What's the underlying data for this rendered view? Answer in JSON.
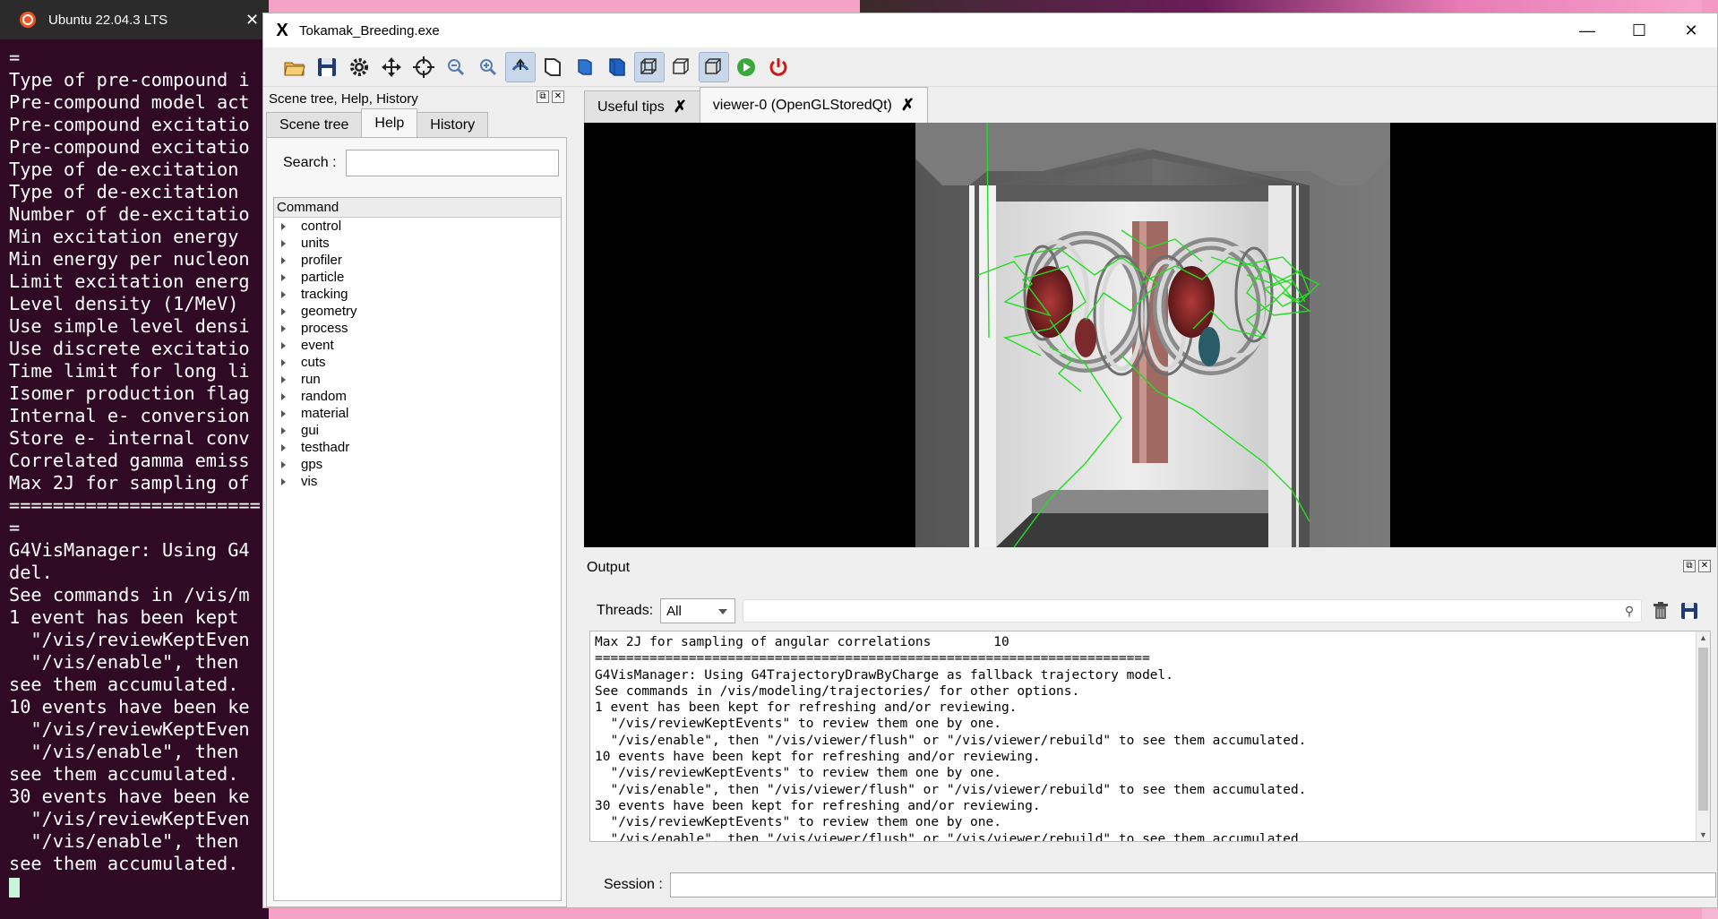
{
  "terminal": {
    "title": "Ubuntu 22.04.3 LTS",
    "close": "✕",
    "lines": [
      "=",
      "Type of pre-compound i",
      "Pre-compound model act",
      "Pre-compound excitatio",
      "Pre-compound excitatio",
      "Type of de-excitation",
      "Type of de-excitation",
      "Number of de-excitatio",
      "Min excitation energy",
      "Min energy per nucleon",
      "Limit excitation energ",
      "Level density (1/MeV)",
      "Use simple level densi",
      "Use discrete excitatio",
      "Time limit for long li",
      "Isomer production flag",
      "Internal e- conversion",
      "Store e- internal conv",
      "Correlated gamma emiss",
      "Max 2J for sampling of",
      "=======================",
      "=",
      "G4VisManager: Using G4",
      "del.",
      "See commands in /vis/m",
      "1 event has been kept",
      "  \"/vis/reviewKeptEven",
      "  \"/vis/enable\", then",
      "see them accumulated.",
      "10 events have been ke",
      "  \"/vis/reviewKeptEven",
      "  \"/vis/enable\", then",
      "see them accumulated.",
      "30 events have been ke",
      "  \"/vis/reviewKeptEven",
      "  \"/vis/enable\", then",
      "see them accumulated."
    ]
  },
  "window": {
    "title": "Tokamak_Breeding.exe",
    "icon": "X",
    "minimize": "—",
    "maximize": "☐",
    "close": "✕"
  },
  "toolbar": {
    "buttons": [
      "open-icon",
      "save-icon",
      "settings-icon",
      "move-icon",
      "pick-icon",
      "zoom-out-icon",
      "zoom-in-icon",
      "rotate-icon",
      "perspective-icon",
      "surface-icon",
      "solid-icon",
      "wireframe-icon",
      "hidden-line-icon",
      "hidden-surface-icon",
      "run-icon",
      "exit-icon"
    ],
    "active": [
      "rotate-icon",
      "wireframe-icon",
      "hidden-surface-icon"
    ]
  },
  "left_dock": {
    "title": "Scene tree, Help, History",
    "tabs": [
      "Scene tree",
      "Help",
      "History"
    ],
    "active_tab": "Help",
    "search_label": "Search :",
    "search_value": "",
    "tree_header": "Command",
    "commands": [
      "control",
      "units",
      "profiler",
      "particle",
      "tracking",
      "geometry",
      "process",
      "event",
      "cuts",
      "run",
      "random",
      "material",
      "gui",
      "testhadr",
      "gps",
      "vis"
    ]
  },
  "viewer_tabs": [
    {
      "label": "Useful tips",
      "close": "✗"
    },
    {
      "label": "viewer-0 (OpenGLStoredQt)",
      "close": "✗"
    }
  ],
  "output": {
    "title": "Output",
    "threads_label": "Threads:",
    "threads_value": "All",
    "search_value": "",
    "lines": [
      "Max 2J for sampling of angular correlations        10",
      "=======================================================================",
      "G4VisManager: Using G4TrajectoryDrawByCharge as fallback trajectory model.",
      "See commands in /vis/modeling/trajectories/ for other options.",
      "1 event has been kept for refreshing and/or reviewing.",
      "  \"/vis/reviewKeptEvents\" to review them one by one.",
      "  \"/vis/enable\", then \"/vis/viewer/flush\" or \"/vis/viewer/rebuild\" to see them accumulated.",
      "10 events have been kept for refreshing and/or reviewing.",
      "  \"/vis/reviewKeptEvents\" to review them one by one.",
      "  \"/vis/enable\", then \"/vis/viewer/flush\" or \"/vis/viewer/rebuild\" to see them accumulated.",
      "30 events have been kept for refreshing and/or reviewing.",
      "  \"/vis/reviewKeptEvents\" to review them one by one.",
      "  \"/vis/enable\", then \"/vis/viewer/flush\" or \"/vis/viewer/rebuild\" to see them accumulated."
    ],
    "session_label": "Session :",
    "session_value": ""
  },
  "colors": {
    "terminal_bg": "#300a24",
    "ubuntu_orange": "#e95420",
    "trajectory": "#22dd22"
  }
}
